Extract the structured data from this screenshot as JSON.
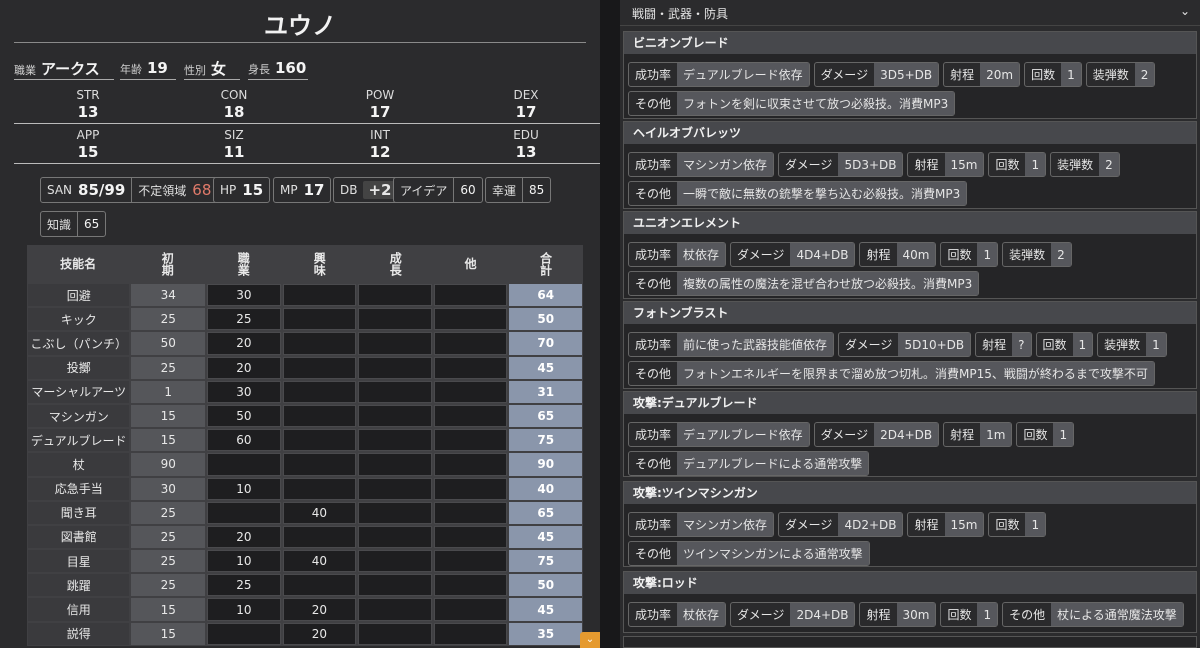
{
  "character": {
    "name": "ユウノ",
    "occupation": {
      "label": "職業",
      "value": "アークス"
    },
    "age": {
      "label": "年齢",
      "value": "19"
    },
    "gender": {
      "label": "性別",
      "value": "女"
    },
    "height": {
      "label": "身長",
      "value": "160"
    }
  },
  "stats": [
    {
      "key": "STR",
      "value": "13"
    },
    {
      "key": "CON",
      "value": "18"
    },
    {
      "key": "POW",
      "value": "17"
    },
    {
      "key": "DEX",
      "value": "17"
    },
    {
      "key": "APP",
      "value": "15"
    },
    {
      "key": "SIZ",
      "value": "11"
    },
    {
      "key": "INT",
      "value": "12"
    },
    {
      "key": "EDU",
      "value": "13"
    }
  ],
  "derived": {
    "san": {
      "label": "SAN",
      "value": "85/99",
      "sub_label": "不定領域",
      "sub_value": "68"
    },
    "hp": {
      "label": "HP",
      "value": "15"
    },
    "mp": {
      "label": "MP",
      "value": "17"
    },
    "db": {
      "label": "DB",
      "value": "+2"
    },
    "idea": {
      "label": "アイデア",
      "value": "60"
    },
    "luck": {
      "label": "幸運",
      "value": "85"
    },
    "knowledge": {
      "label": "知識",
      "value": "65"
    }
  },
  "skills_table": {
    "headers": [
      "技能名",
      "初期",
      "職業",
      "興味",
      "成長",
      "他",
      "合計"
    ],
    "rows": [
      {
        "name": "回避",
        "base": "34",
        "job": "30",
        "interest": "",
        "growth": "",
        "other": "",
        "total": "64"
      },
      {
        "name": "キック",
        "base": "25",
        "job": "25",
        "interest": "",
        "growth": "",
        "other": "",
        "total": "50"
      },
      {
        "name": "こぶし（パンチ）",
        "base": "50",
        "job": "20",
        "interest": "",
        "growth": "",
        "other": "",
        "total": "70"
      },
      {
        "name": "投擲",
        "base": "25",
        "job": "20",
        "interest": "",
        "growth": "",
        "other": "",
        "total": "45"
      },
      {
        "name": "マーシャルアーツ",
        "base": "1",
        "job": "30",
        "interest": "",
        "growth": "",
        "other": "",
        "total": "31"
      },
      {
        "name": "マシンガン",
        "base": "15",
        "job": "50",
        "interest": "",
        "growth": "",
        "other": "",
        "total": "65"
      },
      {
        "name": "デュアルブレード",
        "base": "15",
        "job": "60",
        "interest": "",
        "growth": "",
        "other": "",
        "total": "75"
      },
      {
        "name": "杖",
        "base": "90",
        "job": "",
        "interest": "",
        "growth": "",
        "other": "",
        "total": "90"
      },
      {
        "name": "応急手当",
        "base": "30",
        "job": "10",
        "interest": "",
        "growth": "",
        "other": "",
        "total": "40"
      },
      {
        "name": "聞き耳",
        "base": "25",
        "job": "",
        "interest": "40",
        "growth": "",
        "other": "",
        "total": "65"
      },
      {
        "name": "図書館",
        "base": "25",
        "job": "20",
        "interest": "",
        "growth": "",
        "other": "",
        "total": "45"
      },
      {
        "name": "目星",
        "base": "25",
        "job": "10",
        "interest": "40",
        "growth": "",
        "other": "",
        "total": "75"
      },
      {
        "name": "跳躍",
        "base": "25",
        "job": "25",
        "interest": "",
        "growth": "",
        "other": "",
        "total": "50"
      },
      {
        "name": "信用",
        "base": "15",
        "job": "10",
        "interest": "20",
        "growth": "",
        "other": "",
        "total": "45"
      },
      {
        "name": "説得",
        "base": "15",
        "job": "",
        "interest": "20",
        "growth": "",
        "other": "",
        "total": "35"
      }
    ]
  },
  "right": {
    "section_title": "戦闘・武器・防具",
    "labels": {
      "success": "成功率",
      "damage": "ダメージ",
      "range": "射程",
      "count": "回数",
      "ammo": "装弾数",
      "other": "その他"
    },
    "weapons": [
      {
        "name": "ビニオンブレード",
        "success": "デュアルブレード依存",
        "damage": "3D5+DB",
        "range": "20m",
        "count": "1",
        "ammo": "2",
        "other": "フォトンを剣に収束させて放つ必殺技。消費MP3"
      },
      {
        "name": "ヘイルオブバレッツ",
        "success": "マシンガン依存",
        "damage": "5D3+DB",
        "range": "15m",
        "count": "1",
        "ammo": "2",
        "other": "一瞬で敵に無数の銃撃を撃ち込む必殺技。消費MP3"
      },
      {
        "name": "ユニオンエレメント",
        "success": "杖依存",
        "damage": "4D4+DB",
        "range": "40m",
        "count": "1",
        "ammo": "2",
        "other": "複数の属性の魔法を混ぜ合わせ放つ必殺技。消費MP3"
      },
      {
        "name": "フォトンブラスト",
        "success": "前に使った武器技能値依存",
        "damage": "5D10+DB",
        "range": "?",
        "count": "1",
        "ammo": "1",
        "other": "フォトンエネルギーを限界まで溜め放つ切札。消費MP15、戦闘が終わるまで攻撃不可"
      },
      {
        "name": "攻撃:デュアルブレード",
        "success": "デュアルブレード依存",
        "damage": "2D4+DB",
        "range": "1m",
        "count": "1",
        "other": "デュアルブレードによる通常攻撃"
      },
      {
        "name": "攻撃:ツインマシンガン",
        "success": "マシンガン依存",
        "damage": "4D2+DB",
        "range": "15m",
        "count": "1",
        "other": "ツインマシンガンによる通常攻撃"
      },
      {
        "name": "攻撃:ロッド",
        "success": "杖依存",
        "damage": "2D4+DB",
        "range": "30m",
        "count": "1",
        "other": "杖による通常魔法攻撃"
      }
    ]
  },
  "icons": {
    "section_chevron": "chevron-down-icon",
    "scroll_tab": "chevron-down-icon"
  },
  "colors": {
    "total_cell": "#8a96ab",
    "scroll_tab": "#e59a2f",
    "unstable": "#e07a6a"
  }
}
